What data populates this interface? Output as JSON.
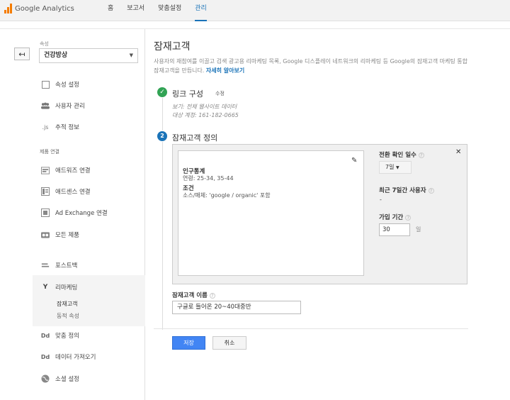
{
  "header": {
    "logo_text": "Google Analytics",
    "nav": [
      "홈",
      "보고서",
      "맞춤설정",
      "관리"
    ],
    "active_nav": "관리",
    "brand_color": "#f57c00",
    "accent_color": "#1a73b8"
  },
  "sidebar": {
    "property_label": "속성",
    "property_value": "건강방상",
    "items_top": [
      {
        "label": "속성 설정",
        "icon": "square-icon"
      },
      {
        "label": "사용자 관리",
        "icon": "users-icon"
      },
      {
        "label": "추적 정보",
        "icon": "js-icon"
      }
    ],
    "section_heading": "제품 연결",
    "items_products": [
      {
        "label": "애드워즈 연결",
        "icon": "adwords-icon"
      },
      {
        "label": "애드센스 연결",
        "icon": "adsense-icon"
      },
      {
        "label": "Ad Exchange 연결",
        "icon": "adexchange-icon"
      },
      {
        "label": "모든 제품",
        "icon": "all-products-icon"
      }
    ],
    "postback": "포스트백",
    "remarketing": {
      "label": "리마케팅",
      "subitems": [
        "잠재고객",
        "동적 속성"
      ]
    },
    "custom_definitions": "맞춤 정의",
    "data_import": "데이터 가져오기",
    "social_settings": "소셜 설정"
  },
  "main": {
    "title": "잠재고객",
    "description_line1": "사용자의 재참여를 이끌고 검색 광고용 리마케팅 목록, Google 디스플레이 네트워크의 리마케팅 등 Google의 잠재고객 마케팅 통합",
    "description_line2": "잠재고객을 만듭니다.",
    "learn_more": "자세히 알아보기",
    "step1": {
      "title": "링크 구성",
      "edit": "수정",
      "view_line": "보기: 전체 웹사이트 데이터",
      "target_line": "대상 계정: 161-182-0665"
    },
    "step2": {
      "number": "2",
      "title": "잠재고객 정의",
      "demographics_heading": "인구통계",
      "demographics_text": "연령: 25-34, 35-44",
      "conditions_heading": "조건",
      "conditions_text": "소스/매체: 'google / organic' 포함",
      "lookback_label": "전환 확인 일수",
      "lookback_value": "7일",
      "users_label": "최근 7일간 사용자",
      "users_value": "-",
      "duration_label": "가입 기간",
      "duration_value": "30",
      "duration_unit": "일"
    },
    "audience_name_label": "잠재고객 이름",
    "audience_name_value": "구글로 들어온 20~40대중반",
    "save_label": "저장",
    "cancel_label": "취소"
  }
}
